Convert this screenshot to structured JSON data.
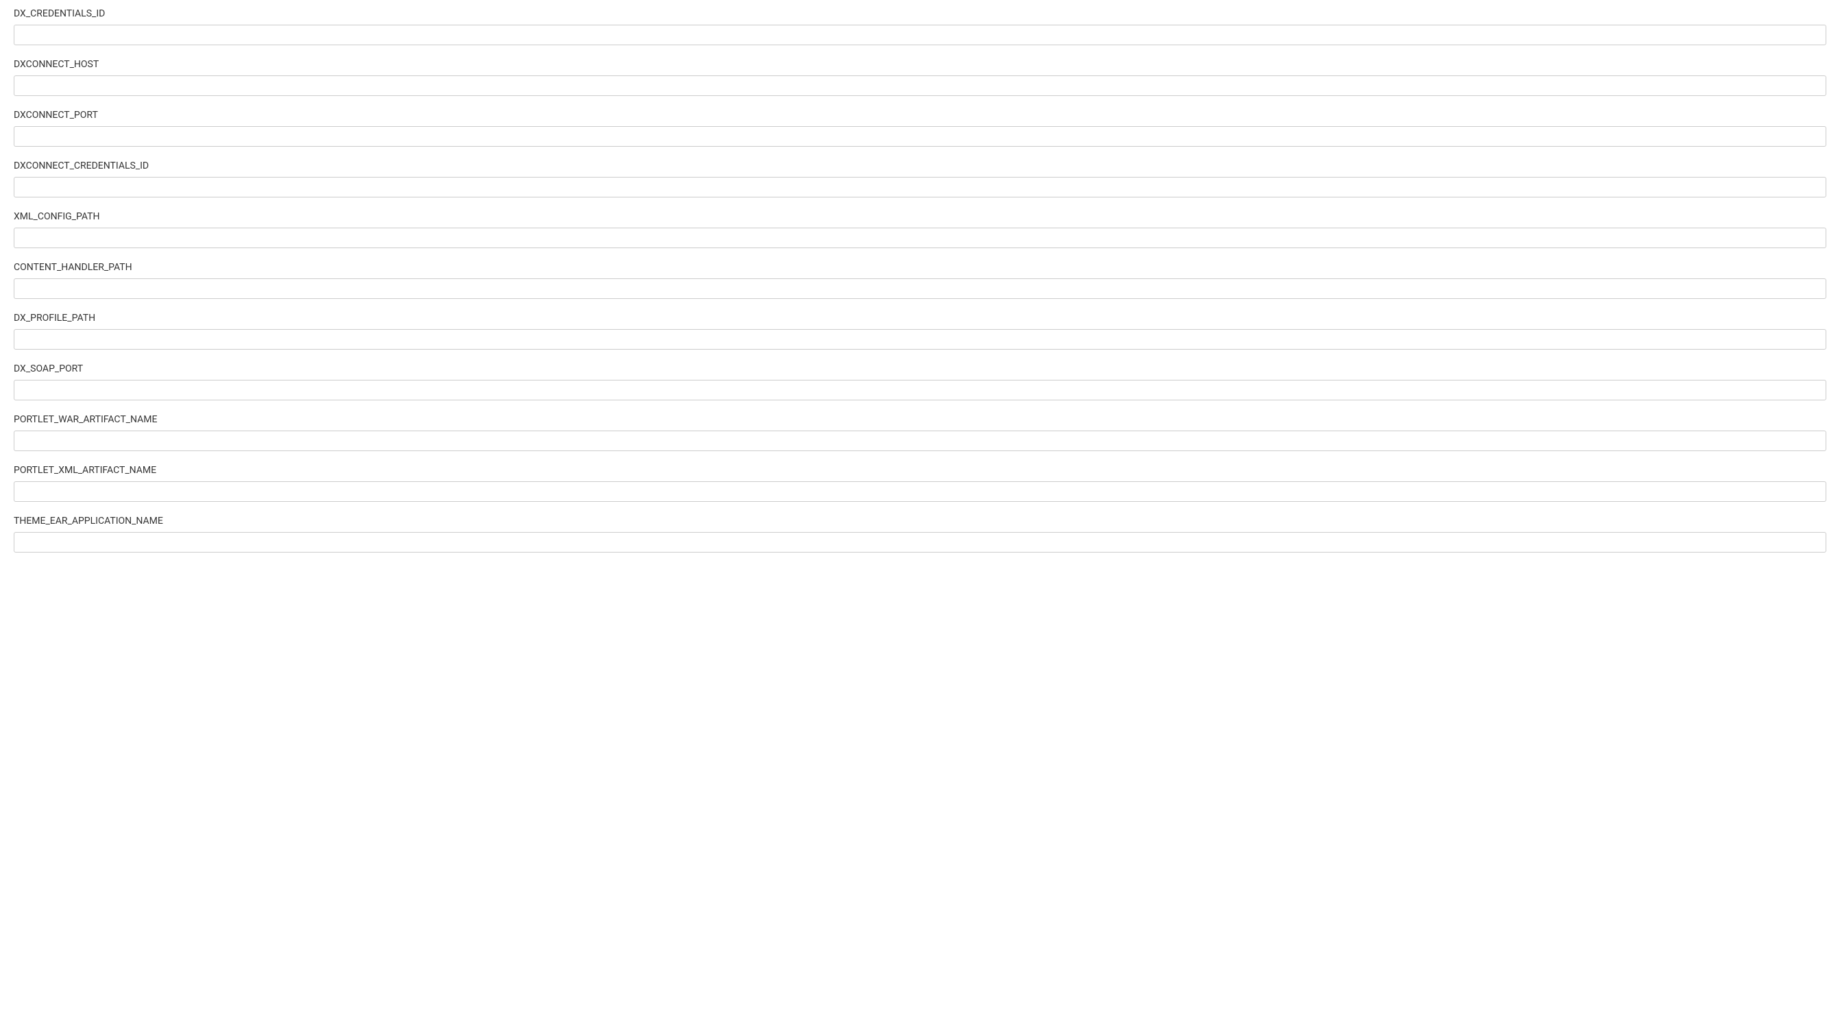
{
  "fields": [
    {
      "label": "DX_CREDENTIALS_ID",
      "value": ""
    },
    {
      "label": "DXCONNECT_HOST",
      "value": ""
    },
    {
      "label": "DXCONNECT_PORT",
      "value": ""
    },
    {
      "label": "DXCONNECT_CREDENTIALS_ID",
      "value": ""
    },
    {
      "label": "XML_CONFIG_PATH",
      "value": ""
    },
    {
      "label": "CONTENT_HANDLER_PATH",
      "value": ""
    },
    {
      "label": "DX_PROFILE_PATH",
      "value": ""
    },
    {
      "label": "DX_SOAP_PORT",
      "value": ""
    },
    {
      "label": "PORTLET_WAR_ARTIFACT_NAME",
      "value": ""
    },
    {
      "label": "PORTLET_XML_ARTIFACT_NAME",
      "value": ""
    },
    {
      "label": "THEME_EAR_APPLICATION_NAME",
      "value": ""
    }
  ]
}
